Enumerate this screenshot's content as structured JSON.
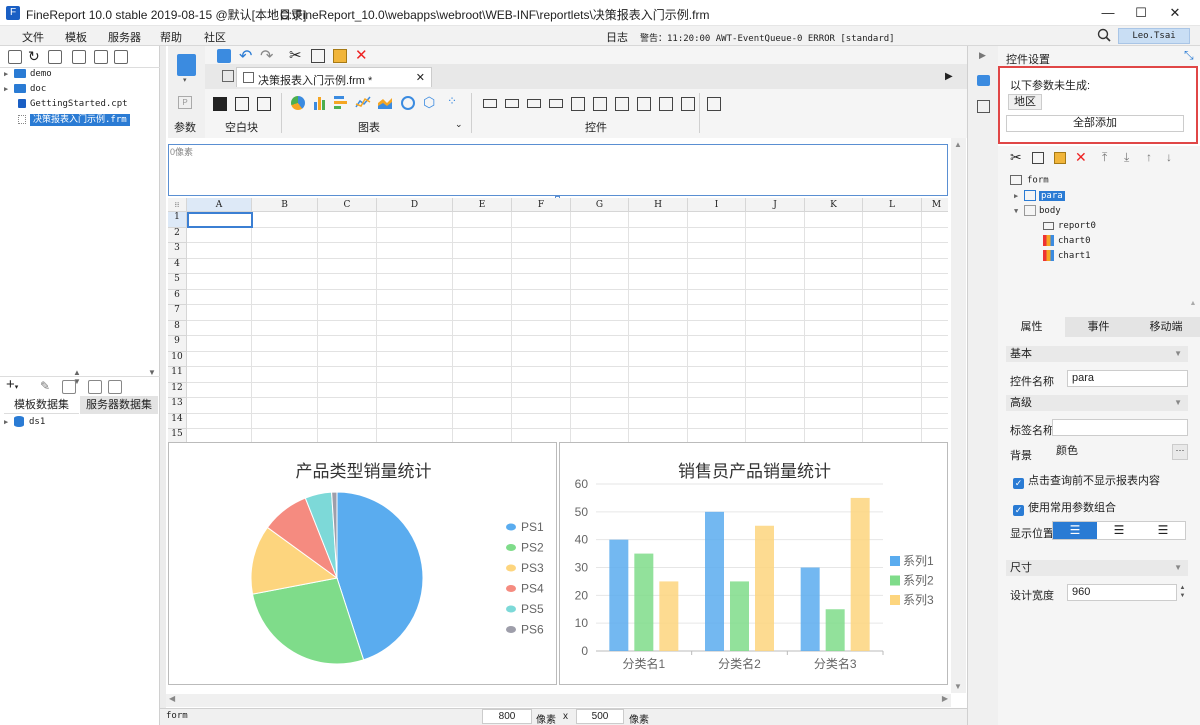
{
  "window": {
    "app_title": "FineReport 10.0 stable 2019-08-15 @默认[本地目录]",
    "file_path": "C:\\FineReport_10.0\\webapps\\webroot\\WEB-INF\\reportlets\\决策报表入门示例.frm",
    "minimize": "—",
    "maximize": "☐",
    "close": "✕"
  },
  "menu": [
    "文件",
    "模板",
    "服务器",
    "帮助",
    "社区"
  ],
  "status_top": {
    "log": "日志",
    "alarm": "警告：11:20:00 AWT-EventQueue-0 ERROR [standard]"
  },
  "user": "Leo.Tsai",
  "left_tree": [
    {
      "label": "demo",
      "type": "folder",
      "expanded": false
    },
    {
      "label": "doc",
      "type": "folder",
      "expanded": false
    },
    {
      "label": "GettingStarted.cpt",
      "type": "file"
    },
    {
      "label": "决策报表入门示例.frm",
      "type": "file",
      "selected": true
    }
  ],
  "dataset_tabs": [
    "模板数据集",
    "服务器数据集"
  ],
  "datasets": [
    "ds1"
  ],
  "editor_tab": "决策报表入门示例.frm *",
  "toolbar_sections": {
    "param": "参数",
    "block": "空白块",
    "chart": "图表",
    "widget": "控件"
  },
  "param_band_text": "0像素",
  "columns": [
    "A",
    "B",
    "C",
    "D",
    "E",
    "F",
    "G",
    "H",
    "I",
    "J",
    "K",
    "L",
    "M"
  ],
  "rows": [
    "1",
    "2",
    "3",
    "4",
    "5",
    "6",
    "7",
    "8",
    "9",
    "10",
    "11",
    "12",
    "13",
    "14",
    "15"
  ],
  "charts": {
    "pie_title": "产品类型销量统计",
    "bar_title": "销售员产品销量统计"
  },
  "chart_data": [
    {
      "type": "pie",
      "title": "产品类型销量统计",
      "labels": [
        "PS1",
        "PS2",
        "PS3",
        "PS4",
        "PS5",
        "PS6"
      ],
      "values": [
        45,
        27,
        13,
        9,
        5,
        1
      ],
      "colors": [
        "#5aacef",
        "#7fdc8a",
        "#fdd57e",
        "#f58b80",
        "#7dd9d8",
        "#9e9eaa"
      ]
    },
    {
      "type": "bar",
      "title": "销售员产品销量统计",
      "categories": [
        "分类名1",
        "分类名2",
        "分类名3"
      ],
      "series": [
        {
          "name": "系列1",
          "values": [
            40,
            50,
            30
          ],
          "color": "#5aacef"
        },
        {
          "name": "系列2",
          "values": [
            35,
            25,
            15
          ],
          "color": "#7fdc8a"
        },
        {
          "name": "系列3",
          "values": [
            25,
            45,
            55
          ],
          "color": "#fdd57e"
        }
      ],
      "ylim": [
        0,
        60
      ],
      "yticks": [
        0,
        10,
        20,
        30,
        40,
        50,
        60
      ],
      "grid": true,
      "legend": "right"
    }
  ],
  "right_panel": {
    "title": "控件设置",
    "notice": "以下参数未生成:",
    "param_chip": "地区",
    "add_all": "全部添加",
    "tree": [
      {
        "label": "form",
        "level": 0
      },
      {
        "label": "para",
        "level": 1,
        "selected": true
      },
      {
        "label": "body",
        "level": 1
      },
      {
        "label": "report0",
        "level": 2
      },
      {
        "label": "chart0",
        "level": 2
      },
      {
        "label": "chart1",
        "level": 2
      }
    ],
    "tabs": [
      "属性",
      "事件",
      "移动端"
    ],
    "basic": "基本",
    "widget_name_label": "控件名称",
    "widget_name": "para",
    "advanced": "高级",
    "tag_name_label": "标签名称",
    "tag_name": "",
    "bg_label": "背景",
    "bg_value": "颜色",
    "chk1": "点击查询前不显示报表内容",
    "chk2": "使用常用参数组合",
    "display_pos": "显示位置",
    "size": "尺寸",
    "design_width_label": "设计宽度",
    "design_width": "960"
  },
  "status_bottom": {
    "name": "form",
    "width": "800",
    "px": "像素",
    "x": "x",
    "height": "500",
    "px2": "像素"
  }
}
